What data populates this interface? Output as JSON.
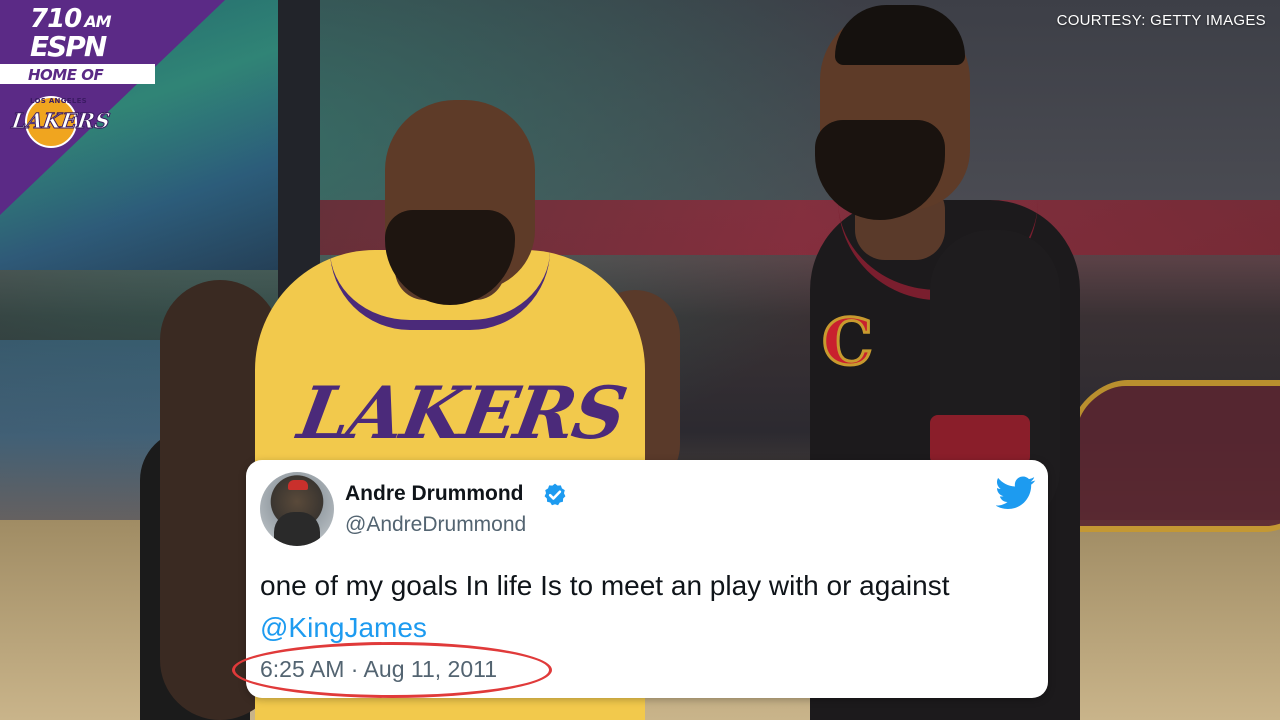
{
  "watermark": {
    "station_number": "710",
    "station_band": "AM",
    "network": "ESPN",
    "tagline": "HOME OF",
    "team_logo_text": "LAKERS",
    "team_logo_city": "LOS ANGELES"
  },
  "courtesy": "COURTESY: GETTY IMAGES",
  "photo": {
    "jersey_left": "LAKERS",
    "jersey_right": "C"
  },
  "tweet": {
    "display_name": "Andre Drummond",
    "handle": "@AndreDrummond",
    "verified": true,
    "text": "one of my goals In life Is to meet an play with or against",
    "mention": "@KingJames",
    "timestamp": "6:25 AM · Aug 11, 2011"
  },
  "colors": {
    "lakers_purple": "#5b2a86",
    "lakers_gold": "#f2c94c",
    "twitter_blue": "#1d9bf0",
    "highlight_red": "#e03a3a"
  },
  "icons": {
    "verified": "verified-badge-icon",
    "twitter": "twitter-bird-icon"
  }
}
